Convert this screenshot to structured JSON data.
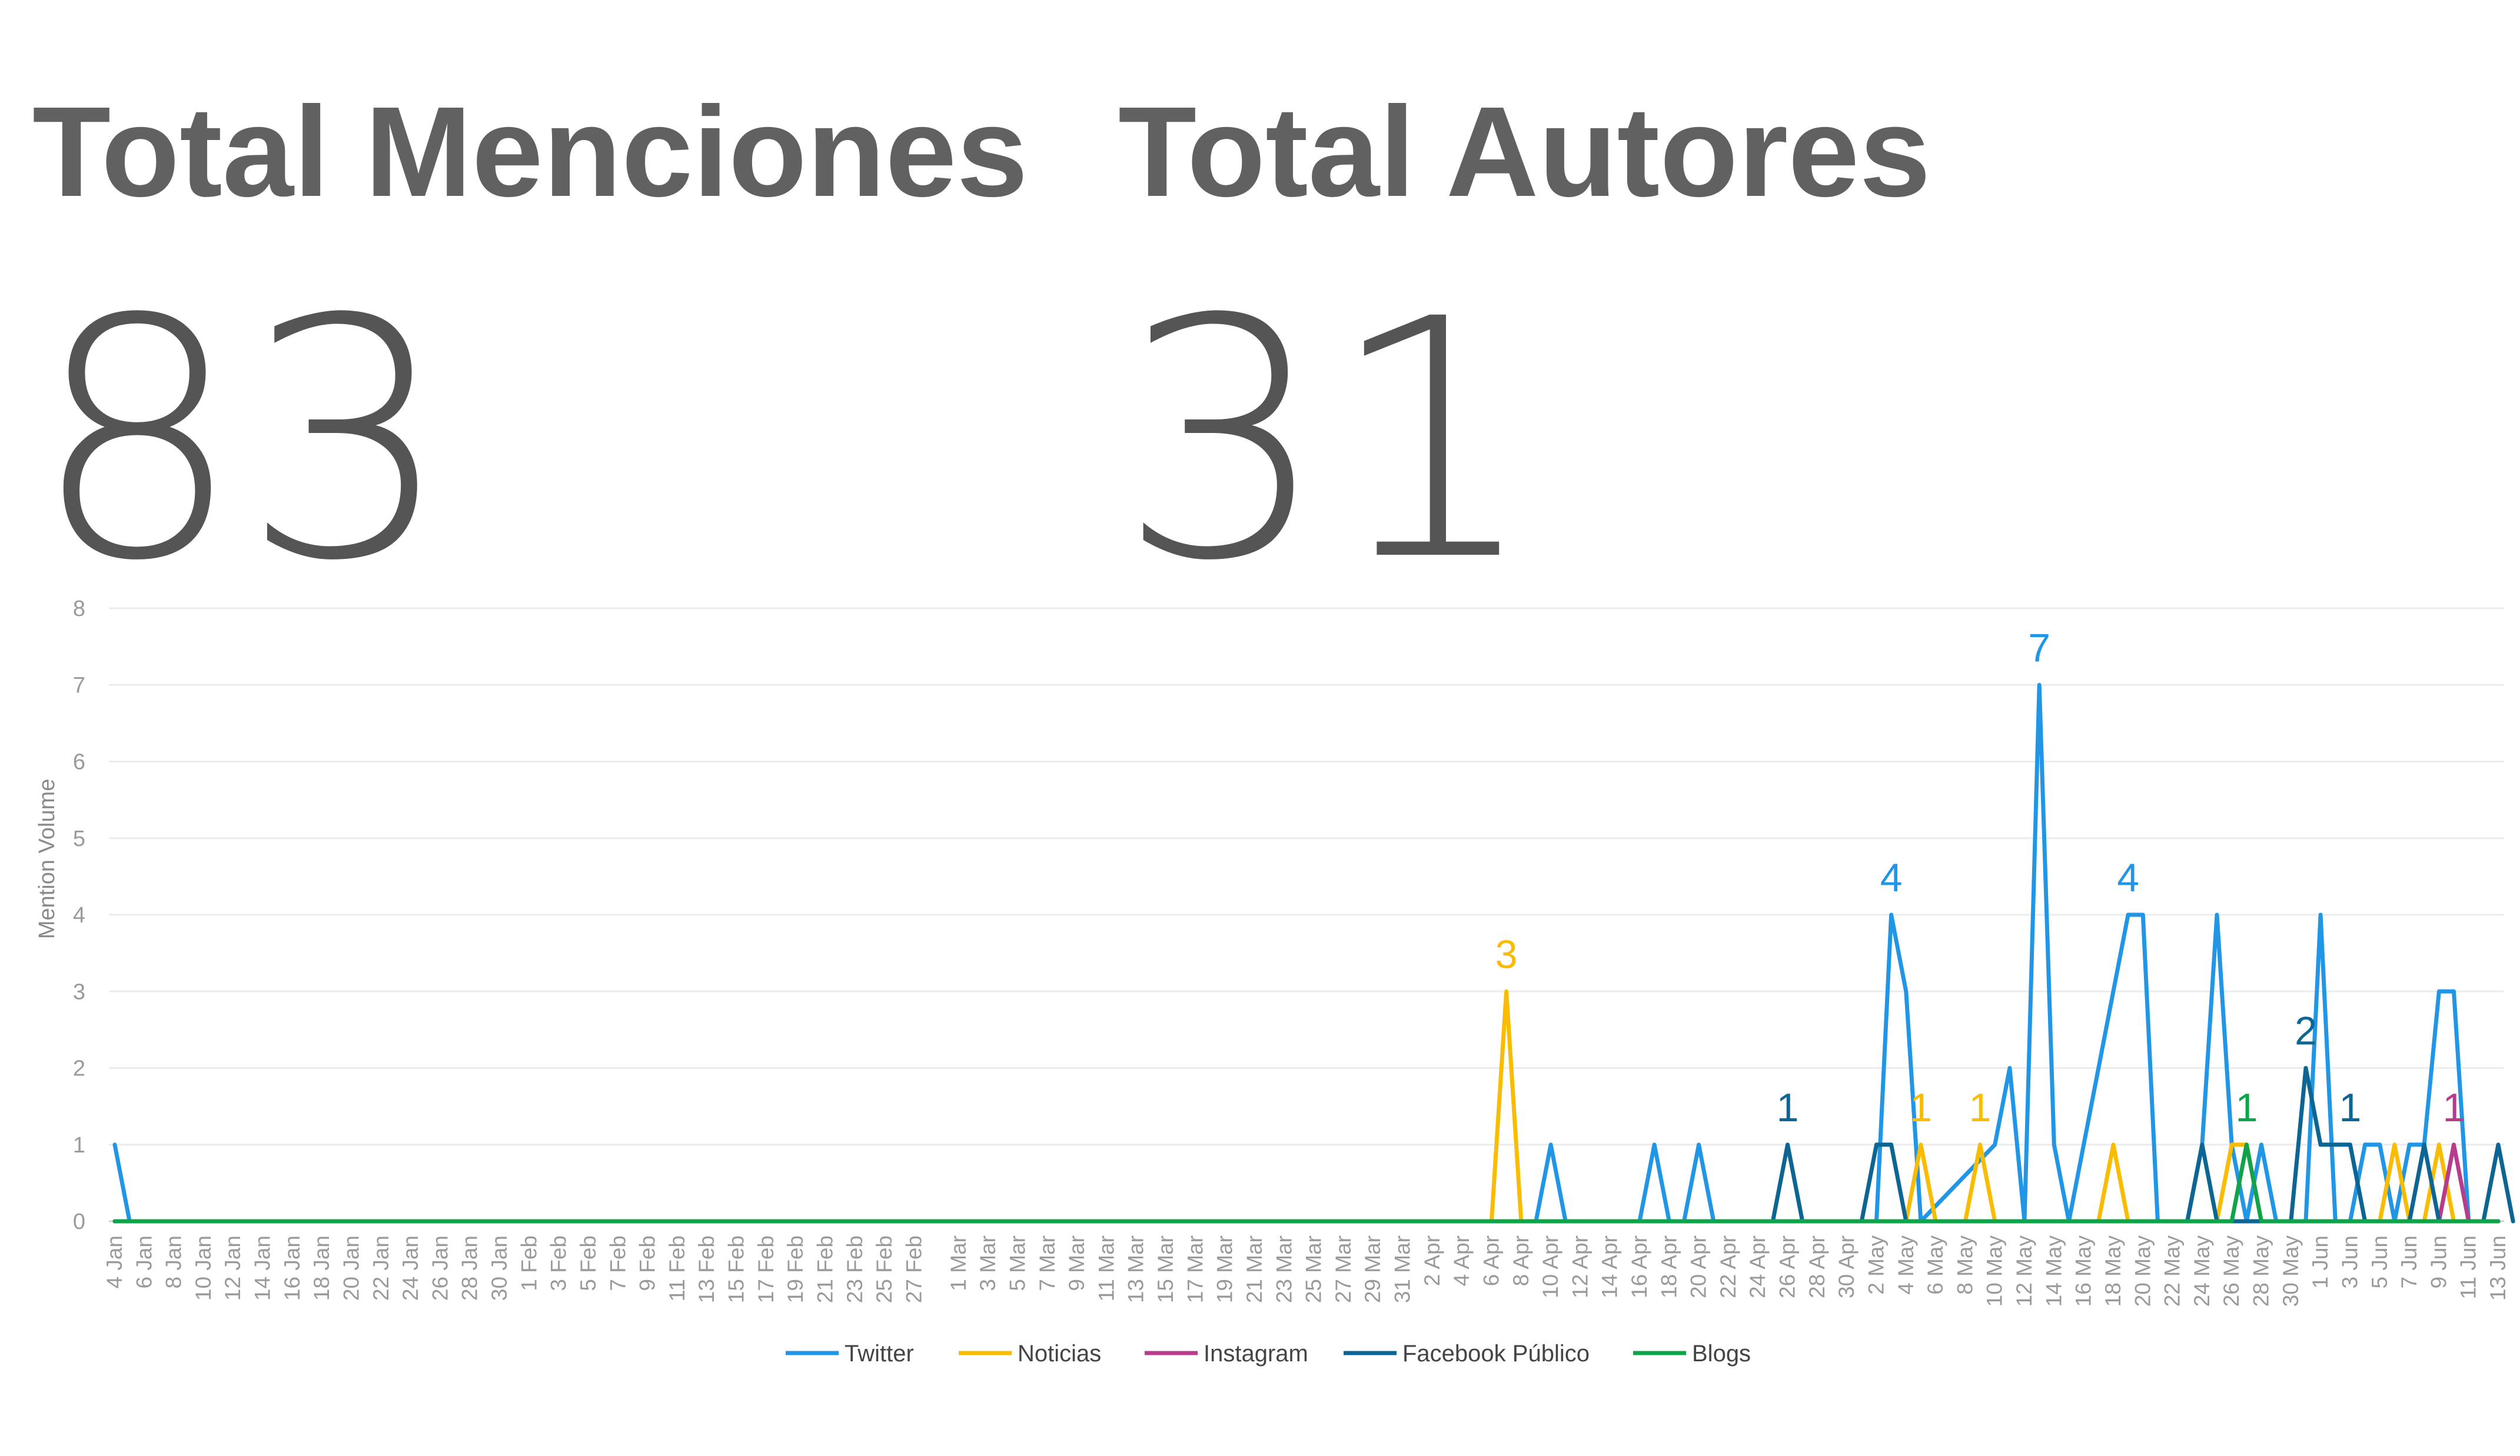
{
  "kpis": [
    {
      "title": "Total Menciones",
      "value": "83"
    },
    {
      "title": "Total Autores",
      "value": "31"
    }
  ],
  "chart_data": {
    "type": "line",
    "title": "",
    "xlabel": "",
    "ylabel": "Mention Volume",
    "ylim": [
      0,
      8
    ],
    "yticks": [
      0,
      1,
      2,
      3,
      4,
      5,
      6,
      7,
      8
    ],
    "grid": true,
    "legend_position": "bottom-center",
    "x_start": "4 Jan",
    "x_end": "13 Jun",
    "x_tick_labels": [
      "4 Jan",
      "6 Jan",
      "8 Jan",
      "10 Jan",
      "12 Jan",
      "14 Jan",
      "16 Jan",
      "18 Jan",
      "20 Jan",
      "22 Jan",
      "24 Jan",
      "26 Jan",
      "28 Jan",
      "30 Jan",
      "1 Feb",
      "3 Feb",
      "5 Feb",
      "7 Feb",
      "9 Feb",
      "11 Feb",
      "13 Feb",
      "15 Feb",
      "17 Feb",
      "19 Feb",
      "21 Feb",
      "23 Feb",
      "25 Feb",
      "27 Feb",
      "1 Mar",
      "3 Mar",
      "5 Mar",
      "7 Mar",
      "9 Mar",
      "11 Mar",
      "13 Mar",
      "15 Mar",
      "17 Mar",
      "19 Mar",
      "21 Mar",
      "23 Mar",
      "25 Mar",
      "27 Mar",
      "29 Mar",
      "31 Mar",
      "2 Apr",
      "4 Apr",
      "6 Apr",
      "8 Apr",
      "10 Apr",
      "12 Apr",
      "14 Apr",
      "16 Apr",
      "18 Apr",
      "20 Apr",
      "22 Apr",
      "24 Apr",
      "26 Apr",
      "28 Apr",
      "30 Apr",
      "2 May",
      "4 May",
      "6 May",
      "8 May",
      "10 May",
      "12 May",
      "14 May",
      "16 May",
      "18 May",
      "20 May",
      "22 May",
      "24 May",
      "26 May",
      "28 May",
      "30 May",
      "1 Jun",
      "3 Jun",
      "5 Jun",
      "7 Jun",
      "9 Jun",
      "11 Jun",
      "13 Jun"
    ],
    "series": [
      {
        "name": "Twitter",
        "color": "#2196e6",
        "points": [
          [
            "4 Jan",
            1
          ],
          [
            "5 Jan",
            0
          ],
          [
            "9 Apr",
            0
          ],
          [
            "10 Apr",
            1
          ],
          [
            "11 Apr",
            0
          ],
          [
            "16 Apr",
            0
          ],
          [
            "17 Apr",
            1
          ],
          [
            "18 Apr",
            0
          ],
          [
            "19 Apr",
            0
          ],
          [
            "20 Apr",
            1
          ],
          [
            "21 Apr",
            0
          ],
          [
            "2 May",
            0
          ],
          [
            "3 May",
            4
          ],
          [
            "4 May",
            3
          ],
          [
            "5 May",
            0
          ],
          [
            "10 May",
            1
          ],
          [
            "11 May",
            2
          ],
          [
            "12 May",
            0
          ],
          [
            "13 May",
            7
          ],
          [
            "14 May",
            1
          ],
          [
            "15 May",
            0
          ],
          [
            "19 May",
            4
          ],
          [
            "20 May",
            4
          ],
          [
            "21 May",
            0
          ],
          [
            "23 May",
            0
          ],
          [
            "24 May",
            1
          ],
          [
            "25 May",
            4
          ],
          [
            "26 May",
            1
          ],
          [
            "27 May",
            0
          ],
          [
            "28 May",
            1
          ],
          [
            "29 May",
            0
          ],
          [
            "31 May",
            0
          ],
          [
            "1 Jun",
            4
          ],
          [
            "2 Jun",
            0
          ],
          [
            "3 Jun",
            0
          ],
          [
            "4 Jun",
            1
          ],
          [
            "5 Jun",
            1
          ],
          [
            "6 Jun",
            0
          ],
          [
            "7 Jun",
            1
          ],
          [
            "8 Jun",
            1
          ],
          [
            "9 Jun",
            3
          ],
          [
            "10 Jun",
            3
          ],
          [
            "11 Jun",
            0
          ],
          [
            "13 Jun",
            0
          ]
        ],
        "labels": [
          [
            "3 May",
            4
          ],
          [
            "13 May",
            7
          ],
          [
            "19 May",
            4
          ]
        ]
      },
      {
        "name": "Noticias",
        "color": "#f9bc02",
        "points": [
          [
            "4 Jan",
            0
          ],
          [
            "6 Apr",
            0
          ],
          [
            "7 Apr",
            3
          ],
          [
            "8 Apr",
            0
          ],
          [
            "4 May",
            0
          ],
          [
            "5 May",
            1
          ],
          [
            "6 May",
            0
          ],
          [
            "8 May",
            0
          ],
          [
            "9 May",
            1
          ],
          [
            "10 May",
            0
          ],
          [
            "17 May",
            0
          ],
          [
            "18 May",
            1
          ],
          [
            "19 May",
            0
          ],
          [
            "25 May",
            0
          ],
          [
            "26 May",
            1
          ],
          [
            "27 May",
            1
          ],
          [
            "28 May",
            0
          ],
          [
            "5 Jun",
            0
          ],
          [
            "6 Jun",
            1
          ],
          [
            "7 Jun",
            0
          ],
          [
            "8 Jun",
            0
          ],
          [
            "9 Jun",
            1
          ],
          [
            "10 Jun",
            0
          ],
          [
            "13 Jun",
            0
          ]
        ],
        "labels": [
          [
            "7 Apr",
            3
          ],
          [
            "5 May",
            1
          ],
          [
            "9 May",
            1
          ]
        ]
      },
      {
        "name": "Instagram",
        "color": "#b73d8c",
        "points": [
          [
            "4 Jan",
            0
          ],
          [
            "9 Jun",
            0
          ],
          [
            "10 Jun",
            1
          ],
          [
            "11 Jun",
            0
          ],
          [
            "13 Jun",
            0
          ]
        ],
        "labels": [
          [
            "10 Jun",
            1
          ]
        ]
      },
      {
        "name": "Facebook Público",
        "color": "#0c6592",
        "points": [
          [
            "4 Jan",
            0
          ],
          [
            "25 Apr",
            0
          ],
          [
            "26 Apr",
            1
          ],
          [
            "27 Apr",
            0
          ],
          [
            "1 May",
            0
          ],
          [
            "2 May",
            1
          ],
          [
            "3 May",
            1
          ],
          [
            "4 May",
            0
          ],
          [
            "23 May",
            0
          ],
          [
            "24 May",
            1
          ],
          [
            "25 May",
            0
          ],
          [
            "30 May",
            0
          ],
          [
            "31 May",
            2
          ],
          [
            "1 Jun",
            1
          ],
          [
            "2 Jun",
            1
          ],
          [
            "3 Jun",
            1
          ],
          [
            "4 Jun",
            0
          ],
          [
            "7 Jun",
            0
          ],
          [
            "8 Jun",
            1
          ],
          [
            "9 Jun",
            0
          ],
          [
            "12 Jun",
            0
          ],
          [
            "13 Jun",
            1
          ],
          [
            "14 Jun",
            0
          ]
        ],
        "labels": [
          [
            "26 Apr",
            1
          ],
          [
            "31 May",
            2
          ],
          [
            "3 Jun",
            1
          ]
        ]
      },
      {
        "name": "Blogs",
        "color": "#0fa34a",
        "points": [
          [
            "4 Jan",
            0
          ],
          [
            "26 May",
            0
          ],
          [
            "27 May",
            1
          ],
          [
            "28 May",
            0
          ],
          [
            "13 Jun",
            0
          ]
        ],
        "labels": [
          [
            "27 May",
            1
          ]
        ]
      }
    ]
  }
}
